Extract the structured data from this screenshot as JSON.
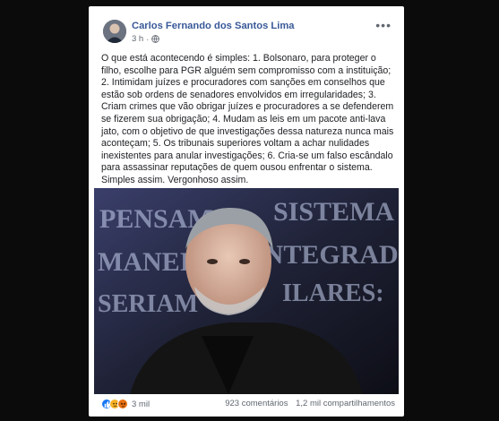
{
  "post": {
    "author": "Carlos Fernando dos Santos Lima",
    "time": "3 h",
    "separator": "·",
    "more_label": "•••",
    "text": "O que está acontecendo é simples: 1. Bolsonaro, para proteger o filho, escolhe para PGR alguém sem compromisso com a instituição; 2. Intimidam juízes e procuradores com sanções em conselhos que estão sob ordens de senadores envolvidos em irregularidades; 3. Criam crimes que vão obrigar juízes e procuradores a se defenderem se fizerem sua obrigação; 4. Mudam as leis em um pacote anti-lava jato, com o objetivo de que investigações dessa natureza nunca mais aconteçam; 5. Os tribunais superiores voltam a achar nulidades inexistentes para anular investigações; 6. Cria-se um falso escândalo para assassinar reputações de quem ousou enfrentar o sistema. Simples assim. Vergonhoso assim.",
    "image": {
      "background_words": [
        "PENSAM",
        "SISTEMA",
        "MANEI",
        "INTEGRADA.",
        "SERIAM",
        "ILARES:"
      ]
    }
  },
  "footer": {
    "reaction_icons": [
      "like-icon",
      "sad-icon",
      "angry-icon"
    ],
    "reactions_count": "3 mil",
    "comments": "923 comentários",
    "shares": "1,2 mil compartilhamentos"
  },
  "colors": {
    "author": "#385898",
    "text": "#1c1e21",
    "meta": "#606770",
    "like": "#1877f2",
    "sad": "#f7b125",
    "angry": "#e9710f"
  }
}
